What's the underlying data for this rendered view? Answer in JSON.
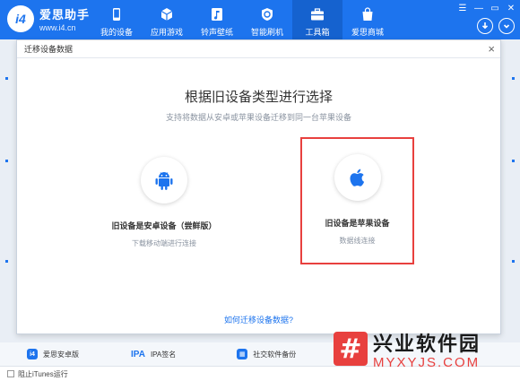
{
  "app": {
    "logo_badge": "i4",
    "name": "爱思助手",
    "url": "www.i4.cn"
  },
  "nav": [
    {
      "label": "我的设备",
      "icon": "phone-icon",
      "active": false
    },
    {
      "label": "应用游戏",
      "icon": "cube-icon",
      "active": false
    },
    {
      "label": "铃声壁纸",
      "icon": "music-icon",
      "active": false
    },
    {
      "label": "智能刷机",
      "icon": "refresh-icon",
      "active": false
    },
    {
      "label": "工具箱",
      "icon": "toolbox-icon",
      "active": true
    },
    {
      "label": "爱思商城",
      "icon": "bag-icon",
      "active": false
    }
  ],
  "dialog": {
    "header": "迁移设备数据",
    "title": "根据旧设备类型进行选择",
    "subtitle": "支持将数据从安卓或苹果设备迁移到同一台苹果设备",
    "options": [
      {
        "label": "旧设备是安卓设备（尝鲜版）",
        "desc": "下载移动端进行连接",
        "icon": "android-icon"
      },
      {
        "label": "旧设备是苹果设备",
        "desc": "数据线连接",
        "icon": "apple-icon",
        "highlighted": true
      }
    ],
    "help_link": "如何迁移设备数据?"
  },
  "bottom_tools": [
    {
      "label": "爱思安卓版",
      "icon": "android-app-icon"
    },
    {
      "label": "IPA签名",
      "prefix": "IPA"
    },
    {
      "label": "社交软件备份",
      "icon": "social-backup-icon"
    }
  ],
  "footer": {
    "checkbox_label": "阻止iTunes运行"
  },
  "watermark": {
    "glyph": "#",
    "cn": "兴业软件园",
    "en": "MYXYJS.COM"
  },
  "colors": {
    "brand": "#1d74ee",
    "highlight": "#e8403e"
  }
}
